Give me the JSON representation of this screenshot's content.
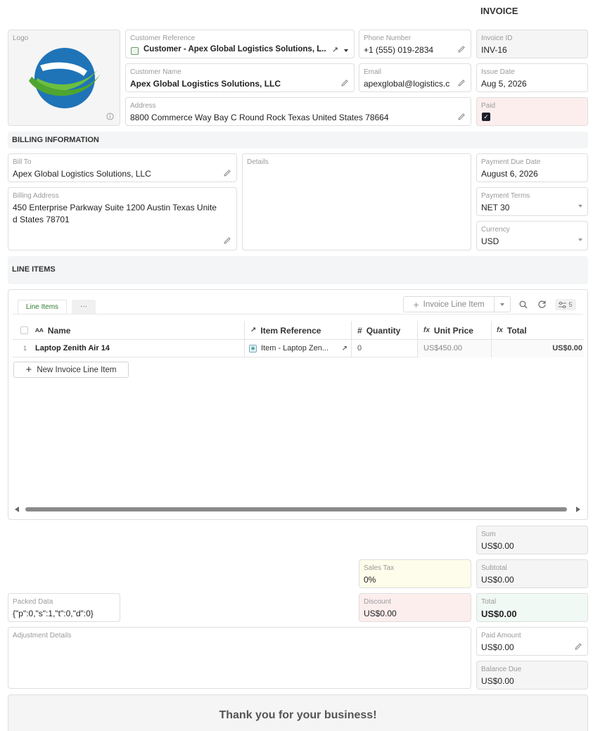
{
  "header": {
    "title": "INVOICE"
  },
  "logo": {
    "label": "Logo",
    "icon": "logo-globe-icon",
    "info_icon": "info-icon"
  },
  "customer_reference": {
    "label": "Customer Reference",
    "value": "Customer - Apex Global Logistics Solutions, L..."
  },
  "phone": {
    "label": "Phone Number",
    "value": "+1 (555) 019-2834"
  },
  "invoice_id": {
    "label": "Invoice ID",
    "value": "INV-16"
  },
  "customer_name": {
    "label": "Customer Name",
    "value": "Apex Global Logistics Solutions, LLC"
  },
  "email": {
    "label": "Email",
    "value": "apexglobal@logistics.c"
  },
  "issue_date": {
    "label": "Issue Date",
    "value": "Aug 5, 2026"
  },
  "address": {
    "label": "Address",
    "value": "8800 Commerce Way Bay C Round Rock Texas United States 78664"
  },
  "paid": {
    "label": "Paid",
    "checked": true
  },
  "billing": {
    "section_title": "BILLING INFORMATION",
    "bill_to": {
      "label": "Bill To",
      "value": "Apex Global Logistics Solutions, LLC"
    },
    "billing_address": {
      "label": "Billing Address",
      "line1": "450 Enterprise Parkway Suite 1200 Austin Texas Unite",
      "line2": "d States 78701"
    },
    "details": {
      "label": "Details",
      "value": ""
    },
    "payment_due_date": {
      "label": "Payment Due Date",
      "value": "August 6, 2026"
    },
    "payment_terms": {
      "label": "Payment Terms",
      "value": "NET 30"
    },
    "currency": {
      "label": "Currency",
      "value": "USD"
    }
  },
  "line_items": {
    "section_title": "LINE ITEMS",
    "tabs": [
      {
        "label": "Line Items"
      },
      {
        "label": "···"
      }
    ],
    "add_button": "Invoice Line Item",
    "filter_count": "5",
    "columns": {
      "name": "Name",
      "item_reference": "Item Reference",
      "quantity": "Quantity",
      "unit_price": "Unit Price",
      "total": "Total"
    },
    "rows": [
      {
        "index": "1",
        "name": "Laptop Zenith Air 14",
        "item_reference": "Item - Laptop Zen...",
        "quantity": "0",
        "unit_price": "US$450.00",
        "total": "US$0.00"
      }
    ],
    "new_button": "New Invoice Line Item"
  },
  "totals": {
    "sum": {
      "label": "Sum",
      "value": "US$0.00"
    },
    "sales_tax": {
      "label": "Sales Tax",
      "value": "0%"
    },
    "subtotal": {
      "label": "Subtotal",
      "value": "US$0.00"
    },
    "packed_data": {
      "label": "Packed Data",
      "value": "{\"p\":0,\"s\":1,\"t\":0,\"d\":0}"
    },
    "discount": {
      "label": "Discount",
      "value": "US$0.00"
    },
    "total": {
      "label": "Total",
      "value": "US$0.00"
    },
    "adjustment_details": {
      "label": "Adjustment Details",
      "value": ""
    },
    "paid_amount": {
      "label": "Paid Amount",
      "value": "US$0.00"
    },
    "balance_due": {
      "label": "Balance Due",
      "value": "US$0.00"
    }
  },
  "footer": {
    "message": "Thank you for your business!"
  },
  "colors": {
    "paid_bg": "#fdeeee",
    "accent_green": "#2e7d32",
    "logo_blue": "#1f74b8",
    "logo_green": "#6cbf3f"
  }
}
